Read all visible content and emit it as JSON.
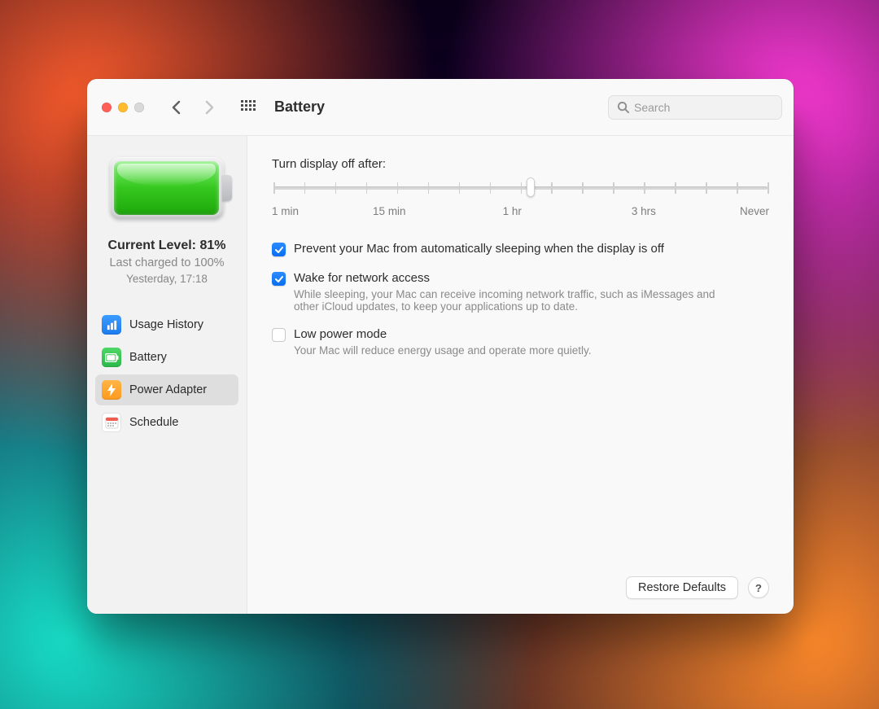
{
  "window": {
    "title": "Battery"
  },
  "search": {
    "placeholder": "Search"
  },
  "sidebar": {
    "current_level_label": "Current Level: 81%",
    "last_charged": "Last charged to 100%",
    "last_charged_ts": "Yesterday, 17:18",
    "items": [
      {
        "label": "Usage History",
        "icon": "usage-history-icon"
      },
      {
        "label": "Battery",
        "icon": "battery-icon"
      },
      {
        "label": "Power Adapter",
        "icon": "power-adapter-icon"
      },
      {
        "label": "Schedule",
        "icon": "schedule-icon"
      }
    ],
    "selected_index": 2
  },
  "main": {
    "slider_label": "Turn display off after:",
    "slider_value_pct": 52,
    "slider_labels": [
      "1 min",
      "15 min",
      "1 hr",
      "3 hrs",
      "Never"
    ],
    "options": [
      {
        "checked": true,
        "title": "Prevent your Mac from automatically sleeping when the display is off",
        "desc": ""
      },
      {
        "checked": true,
        "title": "Wake for network access",
        "desc": "While sleeping, your Mac can receive incoming network traffic, such as iMessages and other iCloud updates, to keep your applications up to date."
      },
      {
        "checked": false,
        "title": "Low power mode",
        "desc": "Your Mac will reduce energy usage and operate more quietly."
      }
    ],
    "restore_button": "Restore Defaults",
    "help_button": "?"
  }
}
